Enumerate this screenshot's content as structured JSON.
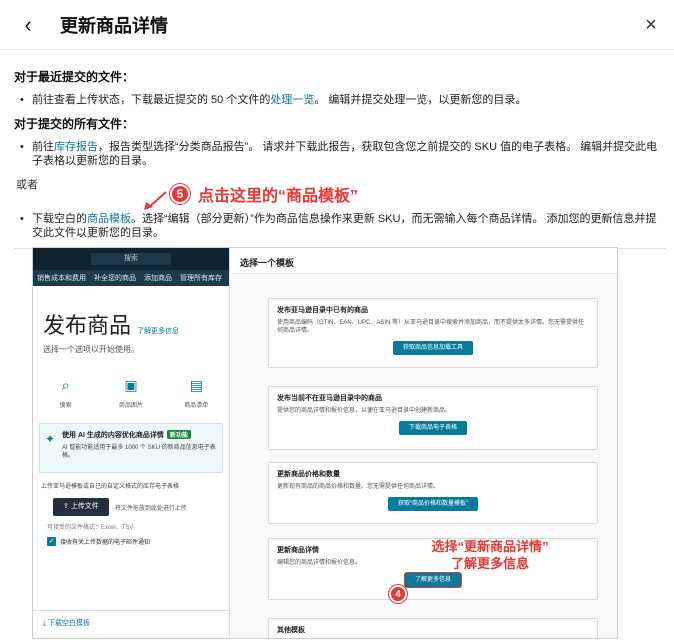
{
  "header": {
    "back_icon": "‹",
    "title": "更新商品详情",
    "close_icon": "×"
  },
  "section1": {
    "heading": "对于最近提交的文件：",
    "bullet_pre": "前往查看上传状态，下载最近提交的 50 个文件的",
    "bullet_link": "处理一览",
    "bullet_post": "。 编辑并提交处理一览，以更新您的目录。"
  },
  "section2": {
    "heading": "对于提交的所有文件：",
    "bullet_pre": "前往",
    "bullet_link": "库存报告",
    "bullet_post": "，报告类型选择“分类商品报告”。 请求并下载此报告，获取包含您之前提交的 SKU 值的电子表格。 编辑并提交此电子表格以更新您的目录。"
  },
  "or_text": "或者",
  "step5": {
    "number": "5",
    "text": "点击这里的“商品模板”"
  },
  "section3": {
    "bullet_pre": "下载空白的",
    "bullet_link": "商品模板",
    "bullet_post": "。选择“编辑（部分更新）”作为商品信息操作来更新 SKU，而无需输入每个商品详情。 添加您的更新信息并提交此文件以更新您的目录。"
  },
  "screenshot": {
    "search_placeholder": "搜索",
    "nav": [
      "销售成本和费用",
      "补全您的商品",
      "添加商品",
      "管理所有库存"
    ],
    "title": "发布商品",
    "learn_more": "了解更多信息",
    "subtitle": "选择一个选项以开始使用。",
    "options": [
      {
        "icon": "search-icon",
        "label": "搜索"
      },
      {
        "icon": "camera-icon",
        "label": "商品图片"
      },
      {
        "icon": "spreadsheet-icon",
        "label": "商品清单"
      }
    ],
    "ai_title": "使用 AI 生成的内容优化商品详情",
    "ai_badge": "新功能",
    "ai_body": "AI 智能功能适用于最多 1000 个 SKU 的新商品信息电子表格。",
    "upload_note": "上传亚马逊模板或自己的自定义格式的库存电子表格",
    "upload_button": "上传文件",
    "upload_drag": "将文件拖放到此处进行上传",
    "formats": "可接受的文件格式：Excel、TSV",
    "checkbox_label": "接收有关上传数据的电子邮件通知",
    "download_template": "下载空白模板",
    "right_header": "选择一个模板",
    "cards": [
      {
        "title": "发布亚马逊目录中已有的商品",
        "desc": "使用商品编码（GTIN、EAN、UPC、ASIN 等）从亚马逊目录中搜索并添加商品，而不提供太多详情。您无需提供任何商品详情。",
        "button": "获取商品信息加载工具"
      },
      {
        "title": "发布当前不在亚马逊目录中的商品",
        "desc": "提供您的商品详情和报价信息，以便在亚马逊目录中创建新商品。",
        "button": "下载商品电子表格"
      },
      {
        "title": "更新商品价格和数量",
        "desc": "更新现有商品的商品价格和数量。您无需提供任何商品详情。",
        "button": "获取“商品价格和数量模板”"
      },
      {
        "title": "更新商品详情",
        "desc": "编辑您的商品详情和报价信息。",
        "button": "了解更多信息"
      },
      {
        "title": "其他模板",
        "desc": "",
        "button": ""
      }
    ]
  },
  "annotation_bottom": {
    "line1": "选择“更新商品详情”",
    "line2": "了解更多信息",
    "step_number": "4"
  },
  "colors": {
    "accent": "#087a9c",
    "annotation_red": "#e53935",
    "topbar": "#102330"
  }
}
